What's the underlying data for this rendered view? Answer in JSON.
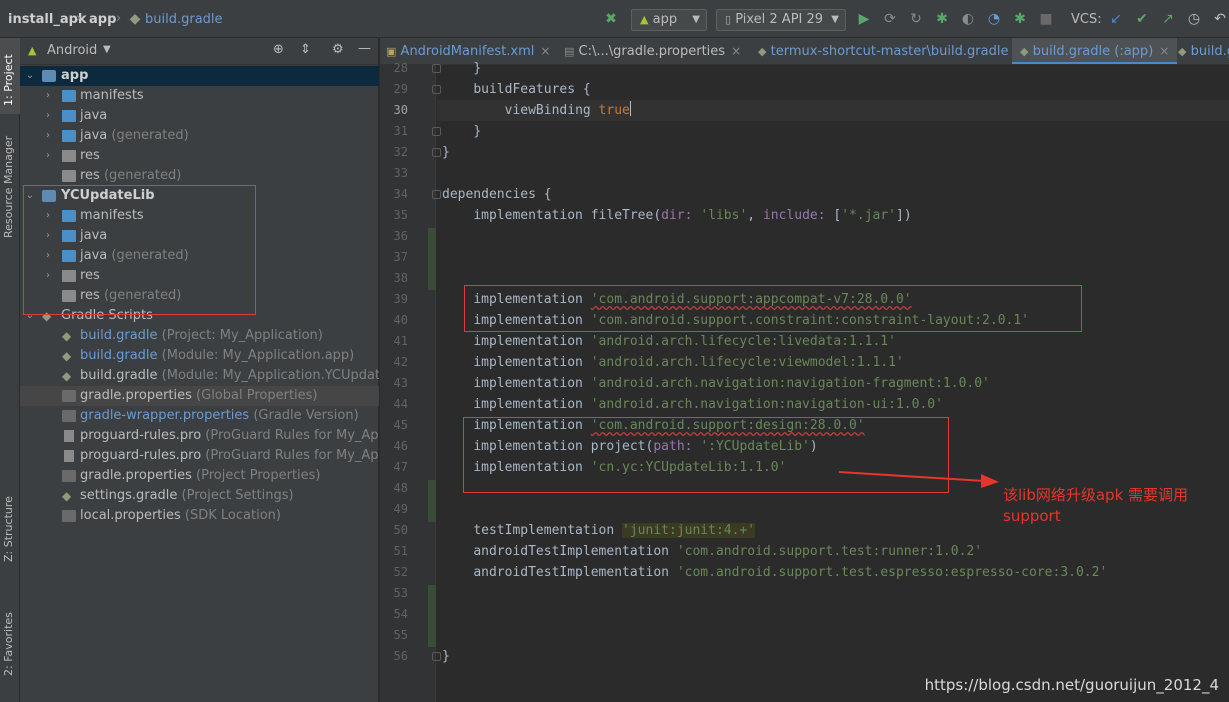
{
  "navbar": {
    "crumbs": [
      "install_apk",
      "app",
      "build.gradle"
    ],
    "run_config": "app",
    "device": "Pixel 2 API 29",
    "vcs_label": "VCS:"
  },
  "stripe": {
    "tabs": [
      "1: Project",
      "Resource Manager",
      "Z: Structure",
      "2: Favorites"
    ]
  },
  "project": {
    "view_mode": "Android",
    "tree": [
      {
        "label": "app",
        "hint": ""
      },
      {
        "label": "manifests",
        "hint": ""
      },
      {
        "label": "java",
        "hint": ""
      },
      {
        "label": "java",
        "hint": "(generated)"
      },
      {
        "label": "res",
        "hint": ""
      },
      {
        "label": "res",
        "hint": "(generated)"
      },
      {
        "label": "YCUpdateLib",
        "hint": ""
      },
      {
        "label": "manifests",
        "hint": ""
      },
      {
        "label": "java",
        "hint": ""
      },
      {
        "label": "java",
        "hint": "(generated)"
      },
      {
        "label": "res",
        "hint": ""
      },
      {
        "label": "res",
        "hint": "(generated)"
      },
      {
        "label": "Gradle Scripts",
        "hint": ""
      },
      {
        "label": "build.gradle",
        "hint": "(Project: My_Application)"
      },
      {
        "label": "build.gradle",
        "hint": "(Module: My_Application.app)"
      },
      {
        "label": "build.gradle",
        "hint": "(Module: My_Application.YCUpdateLib)"
      },
      {
        "label": "gradle.properties",
        "hint": "(Global Properties)"
      },
      {
        "label": "gradle-wrapper.properties",
        "hint": "(Gradle Version)"
      },
      {
        "label": "proguard-rules.pro",
        "hint": "(ProGuard Rules for My_Application.app)"
      },
      {
        "label": "proguard-rules.pro",
        "hint": "(ProGuard Rules for My_Application.YCUpdateLib)"
      },
      {
        "label": "gradle.properties",
        "hint": "(Project Properties)"
      },
      {
        "label": "settings.gradle",
        "hint": "(Project Settings)"
      },
      {
        "label": "local.properties",
        "hint": "(SDK Location)"
      }
    ]
  },
  "tabs": [
    {
      "label": "AndroidManifest.xml"
    },
    {
      "label": "C:\\...\\gradle.properties"
    },
    {
      "label": "termux-shortcut-master\\build.gradle"
    },
    {
      "label": "build.gradle (:app)"
    },
    {
      "label": "build.gradle (:YCUpdateLib)"
    }
  ],
  "editor": {
    "line_numbers": [
      "28",
      "29",
      "30",
      "31",
      "32",
      "33",
      "34",
      "35",
      "36",
      "37",
      "38",
      "39",
      "40",
      "41",
      "42",
      "43",
      "44",
      "45",
      "46",
      "47",
      "48",
      "49",
      "50",
      "51",
      "52",
      "53",
      "54",
      "55",
      "56"
    ],
    "current_line": "30",
    "tokens": {
      "close_brace": "}",
      "buildFeatures": "buildFeatures",
      "open_brace": "{",
      "viewBinding": "viewBinding",
      "true": "true",
      "dependencies": "dependencies",
      "implementation": "implementation",
      "fileTree": "fileTree",
      "dir": "dir:",
      "libs": "'libs'",
      "include": "include:",
      "jar": "'*.jar'",
      "project": "project",
      "path": "path:",
      "testImplementation": "testImplementation",
      "androidTestImplementation": "androidTestImplementation",
      "dep_appcompat": "'com.android.support:appcompat-v7:28.0.0'",
      "dep_constraint": "'com.android.support.constraint:constraint-layout:2.0.1'",
      "dep_livedata": "'android.arch.lifecycle:livedata:1.1.1'",
      "dep_viewmodel": "'android.arch.lifecycle:viewmodel:1.1.1'",
      "dep_navfrag": "'android.arch.navigation:navigation-fragment:1.0.0'",
      "dep_navui": "'android.arch.navigation:navigation-ui:1.0.0'",
      "dep_design": "'com.android.support:design:28.0.0'",
      "dep_ycupdatelib_path": "':YCUpdateLib'",
      "dep_ycupdatelib": "'cn.yc:YCUpdateLib:1.1.0'",
      "dep_junit": "'junit:junit:4.+'",
      "dep_runner": "'com.android.support.test:runner:1.0.2'",
      "dep_espresso": "'com.android.support.test.espresso:espresso-core:3.0.2'"
    }
  },
  "annotation": {
    "line1": "该lib网络升级apk 需要调用",
    "line2": "support"
  },
  "watermark": "https://blog.csdn.net/guoruijun_2012_4",
  "colors": {
    "annotation_red": "#e5352c",
    "keyword": "#cc7832",
    "string": "#6a8759",
    "named_arg": "#9876aa",
    "selection": "#0d293e",
    "tab_underline": "#4a88c7"
  }
}
